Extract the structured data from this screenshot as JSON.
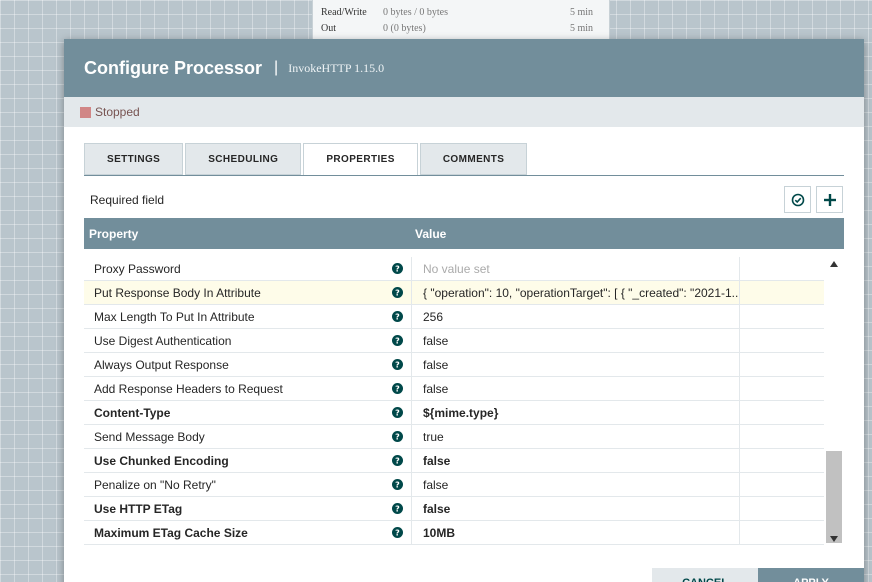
{
  "background_stats": [
    {
      "label": "Read/Write",
      "value": "0 bytes / 0 bytes",
      "time": "5 min"
    },
    {
      "label": "Out",
      "value": "0 (0 bytes)",
      "time": "5 min"
    }
  ],
  "dialog": {
    "title": "Configure Processor",
    "separator": "|",
    "subtitle": "InvokeHTTP 1.15.0",
    "status": "Stopped"
  },
  "tabs": [
    {
      "label": "SETTINGS",
      "active": false
    },
    {
      "label": "SCHEDULING",
      "active": false
    },
    {
      "label": "PROPERTIES",
      "active": true
    },
    {
      "label": "COMMENTS",
      "active": false
    }
  ],
  "required_field_label": "Required field",
  "grid": {
    "headers": {
      "property": "Property",
      "value": "Value"
    },
    "rows": [
      {
        "property": "Proxy Password",
        "value": "No value set",
        "required": false,
        "empty": true
      },
      {
        "property": "Put Response Body In Attribute",
        "value": "{ \"operation\": 10, \"operationTarget\": [ { \"_created\": \"2021-1...",
        "required": false,
        "highlighted": true
      },
      {
        "property": "Max Length To Put In Attribute",
        "value": "256",
        "required": false
      },
      {
        "property": "Use Digest Authentication",
        "value": "false",
        "required": false
      },
      {
        "property": "Always Output Response",
        "value": "false",
        "required": false
      },
      {
        "property": "Add Response Headers to Request",
        "value": "false",
        "required": false
      },
      {
        "property": "Content-Type",
        "value": "${mime.type}",
        "required": true
      },
      {
        "property": "Send Message Body",
        "value": "true",
        "required": false
      },
      {
        "property": "Use Chunked Encoding",
        "value": "false",
        "required": true
      },
      {
        "property": "Penalize on \"No Retry\"",
        "value": "false",
        "required": false
      },
      {
        "property": "Use HTTP ETag",
        "value": "false",
        "required": true
      },
      {
        "property": "Maximum ETag Cache Size",
        "value": "10MB",
        "required": true
      }
    ]
  },
  "buttons": {
    "cancel": "CANCEL",
    "apply": "APPLY"
  },
  "colors": {
    "header": "#728e9b",
    "stopped": "#d18686",
    "help_icon": "#004849",
    "highlight_row": "#fefce9"
  },
  "icons": {
    "help": "question-circle-icon",
    "verify": "check-circle-icon",
    "add": "plus-icon"
  }
}
